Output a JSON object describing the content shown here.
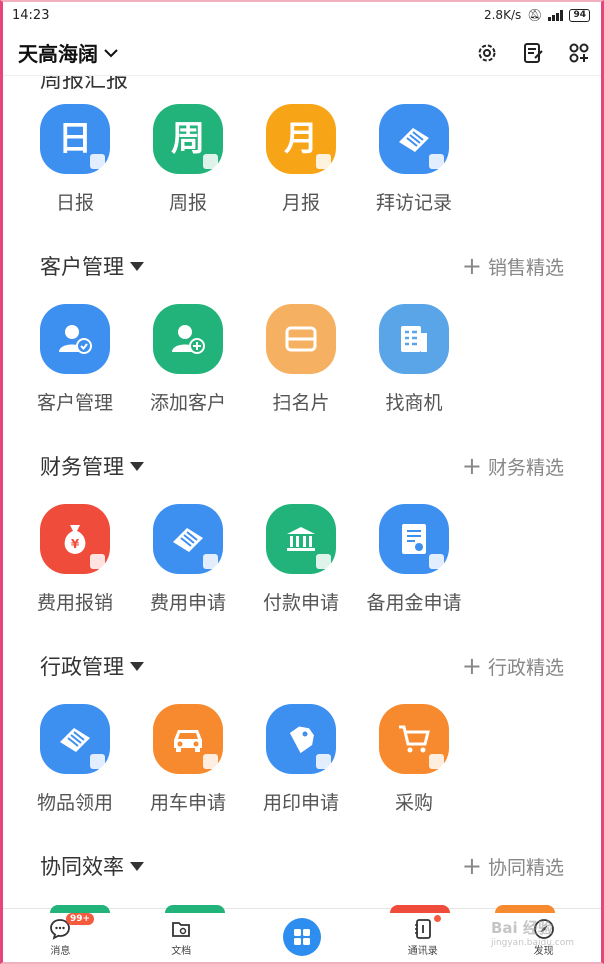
{
  "status_bar": {
    "time": "14:23",
    "speed": "2.8K/s",
    "battery": "94"
  },
  "header": {
    "org_name": "天高海阔"
  },
  "top_tiles": [
    {
      "label": "日报",
      "glyph": "日",
      "color": "#3d8ff0"
    },
    {
      "label": "周报",
      "glyph": "周",
      "color": "#21b37a"
    },
    {
      "label": "月报",
      "glyph": "月",
      "color": "#f7a516"
    },
    {
      "label": "拜访记录",
      "glyph": "",
      "color": "#3d8ff0"
    }
  ],
  "sections": [
    {
      "title": "客户管理",
      "pick": "销售精选",
      "items": [
        {
          "label": "客户管理",
          "color": "#3d8ff0",
          "icon": "user-check-icon"
        },
        {
          "label": "添加客户",
          "color": "#21b37a",
          "icon": "user-add-icon"
        },
        {
          "label": "扫名片",
          "color": "#f5b062",
          "icon": "scan-card-icon"
        },
        {
          "label": "找商机",
          "color": "#5aa4e8",
          "icon": "opportunity-icon"
        }
      ]
    },
    {
      "title": "财务管理",
      "pick": "财务精选",
      "items": [
        {
          "label": "费用报销",
          "color": "#ef4c3c",
          "icon": "money-bag-icon"
        },
        {
          "label": "费用申请",
          "color": "#3d8ff0",
          "icon": "stamp-icon"
        },
        {
          "label": "付款申请",
          "color": "#21b37a",
          "icon": "bank-icon"
        },
        {
          "label": "备用金申请",
          "color": "#3d8ff0",
          "icon": "document-icon"
        }
      ]
    },
    {
      "title": "行政管理",
      "pick": "行政精选",
      "items": [
        {
          "label": "物品领用",
          "color": "#3d8ff0",
          "icon": "stamp-icon"
        },
        {
          "label": "用车申请",
          "color": "#f78a2e",
          "icon": "car-icon"
        },
        {
          "label": "用印申请",
          "color": "#3d8ff0",
          "icon": "tag-icon"
        },
        {
          "label": "采购",
          "color": "#f78a2e",
          "icon": "cart-icon"
        }
      ]
    },
    {
      "title": "协同效率",
      "pick": "协同精选",
      "items": []
    }
  ],
  "tabbar": {
    "messages": "消息",
    "messages_badge": "99+",
    "docs": "文档",
    "contacts": "通讯录",
    "discover": "发现"
  },
  "watermark": {
    "main": "Bai 经验",
    "sub": "jingyan.baidu.com"
  }
}
